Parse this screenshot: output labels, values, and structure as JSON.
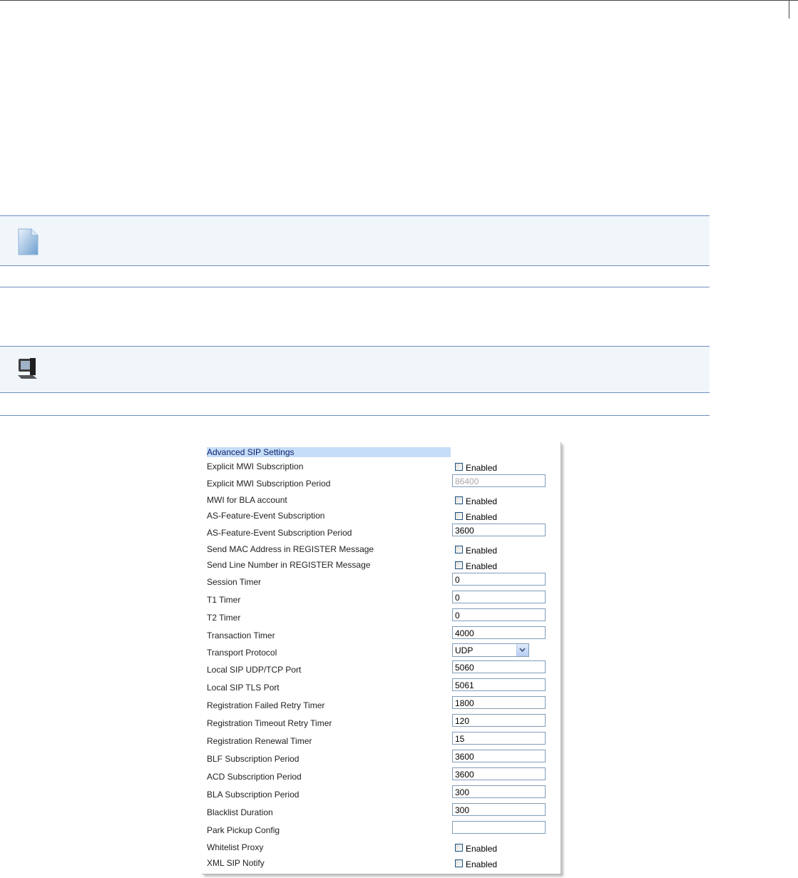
{
  "icons": {
    "note": "note-document-icon",
    "computer": "computer-icon"
  },
  "colors": {
    "note_border": "#6e8fbf",
    "note_bg": "#f1f6fb",
    "panel_title_bg": "#c6ddf7",
    "panel_title_text": "#0b1f6e",
    "input_border": "#7f9db9"
  },
  "panel": {
    "title": "Advanced SIP Settings",
    "rows": [
      {
        "label": "Explicit MWI Subscription",
        "type": "checkbox",
        "option": "Enabled"
      },
      {
        "label": "Explicit MWI Subscription Period",
        "type": "text",
        "value": "86400",
        "disabled": true
      },
      {
        "label": "MWI for BLA account",
        "type": "checkbox",
        "option": "Enabled"
      },
      {
        "label": "AS-Feature-Event Subscription",
        "type": "checkbox",
        "option": "Enabled"
      },
      {
        "label": "AS-Feature-Event Subscription Period",
        "type": "text",
        "value": "3600"
      },
      {
        "label": "Send MAC Address in REGISTER Message",
        "type": "checkbox",
        "option": "Enabled"
      },
      {
        "label": "Send Line Number in REGISTER Message",
        "type": "checkbox",
        "option": "Enabled"
      },
      {
        "label": "Session Timer",
        "type": "text",
        "value": "0"
      },
      {
        "label": "T1 Timer",
        "type": "text",
        "value": "0"
      },
      {
        "label": "T2 Timer",
        "type": "text",
        "value": "0"
      },
      {
        "label": "Transaction Timer",
        "type": "text",
        "value": "4000"
      },
      {
        "label": "Transport Protocol",
        "type": "select",
        "value": "UDP"
      },
      {
        "label": "Local SIP UDP/TCP Port",
        "type": "text",
        "value": "5060"
      },
      {
        "label": "Local SIP TLS Port",
        "type": "text",
        "value": "5061"
      },
      {
        "label": "Registration Failed Retry Timer",
        "type": "text",
        "value": "1800"
      },
      {
        "label": "Registration Timeout Retry Timer",
        "type": "text",
        "value": "120"
      },
      {
        "label": "Registration Renewal Timer",
        "type": "text",
        "value": "15"
      },
      {
        "label": "BLF Subscription Period",
        "type": "text",
        "value": "3600"
      },
      {
        "label": "ACD Subscription Period",
        "type": "text",
        "value": "3600"
      },
      {
        "label": "BLA Subscription Period",
        "type": "text",
        "value": "300"
      },
      {
        "label": "Blacklist Duration",
        "type": "text",
        "value": "300"
      },
      {
        "label": "Park Pickup Config",
        "type": "text",
        "value": ""
      },
      {
        "label": "Whitelist Proxy",
        "type": "checkbox",
        "option": "Enabled"
      },
      {
        "label": "XML SIP Notify",
        "type": "checkbox",
        "option": "Enabled"
      }
    ]
  }
}
